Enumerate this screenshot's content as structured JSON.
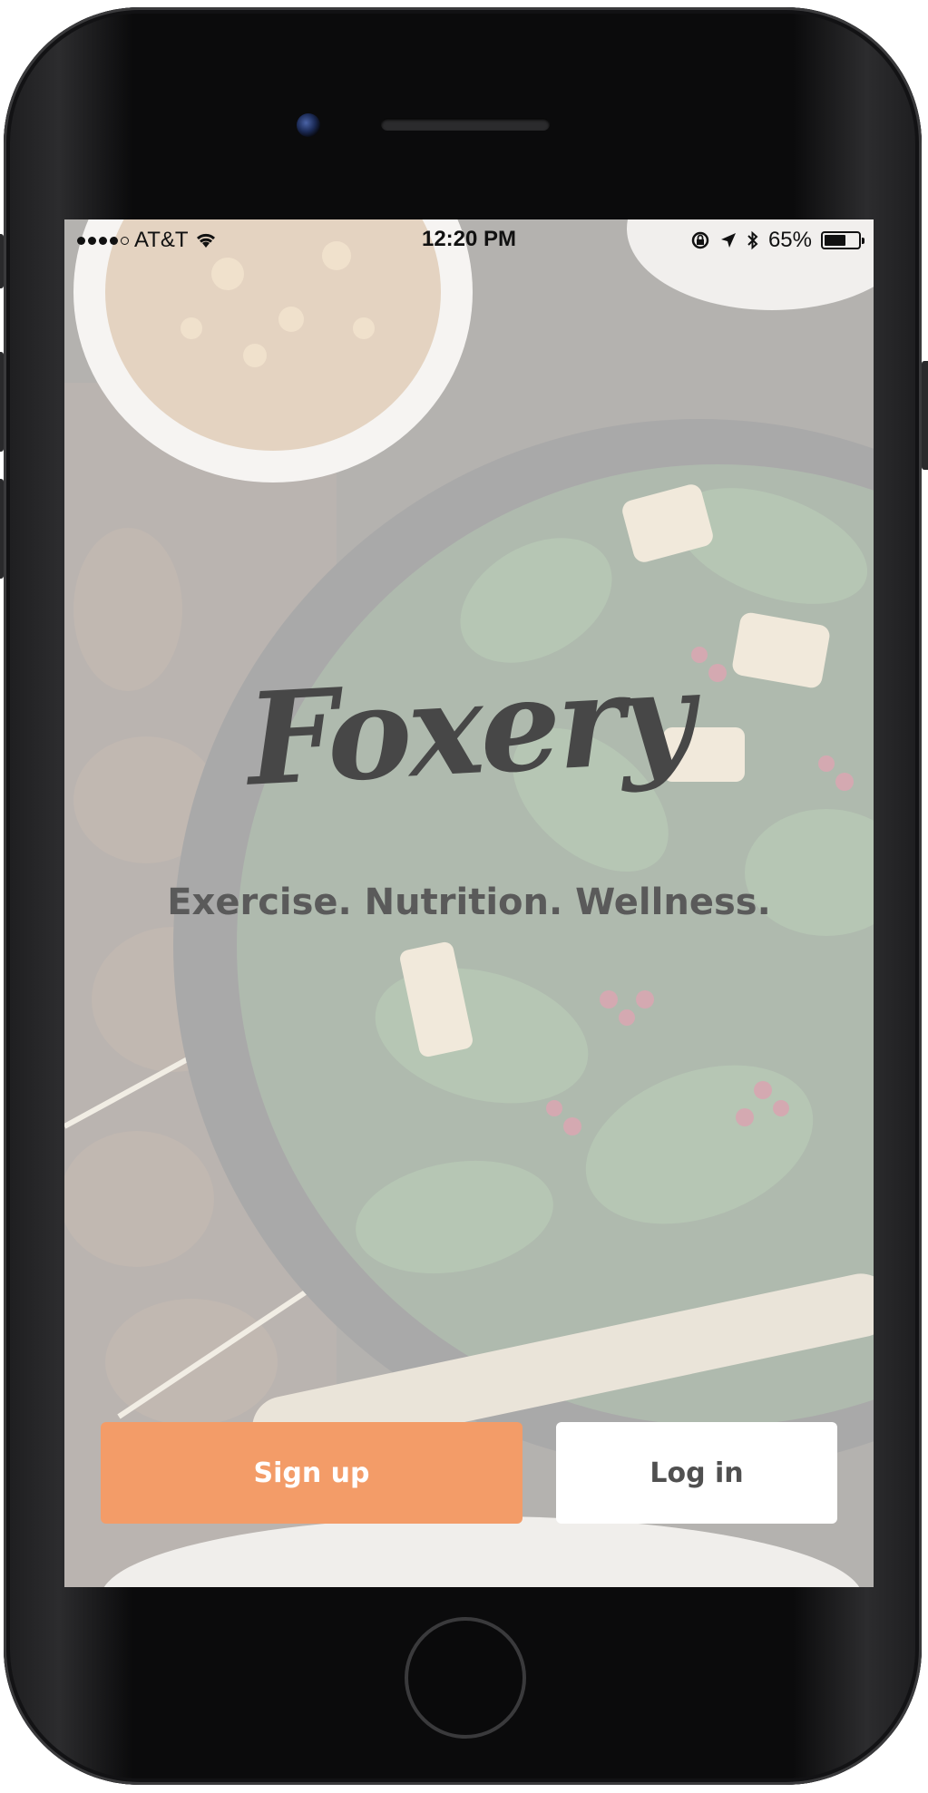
{
  "status_bar": {
    "carrier": "AT&T",
    "time": "12:20 PM",
    "battery": "65%",
    "battery_level": 0.65,
    "signal_bars": 4,
    "signal_total": 5,
    "icons": [
      "wifi-icon",
      "lock-rotation-icon",
      "location-icon",
      "bluetooth-icon",
      "battery-icon"
    ]
  },
  "app": {
    "name": "Foxery",
    "tagline": "Exercise. Nutrition. Wellness."
  },
  "actions": {
    "signup_label": "Sign up",
    "login_label": "Log in"
  },
  "colors": {
    "primary": "#f39c68",
    "secondary": "#ffffff",
    "logo_text": "#474747",
    "tagline_text": "#5a5a5a"
  }
}
